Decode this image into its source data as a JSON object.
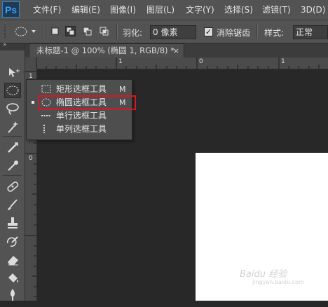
{
  "app": {
    "logo": "Ps"
  },
  "menubar": {
    "items": [
      "文件(F)",
      "编辑(E)",
      "图像(I)",
      "图层(L)",
      "文字(Y)",
      "选择(S)",
      "滤镜(T)",
      "3D(D)"
    ]
  },
  "options": {
    "feather_label": "羽化:",
    "feather_value": "0 像素",
    "antialias_label": "消除锯齿",
    "antialias_checked": true,
    "style_label": "样式:",
    "style_value": "正常"
  },
  "document_tab": {
    "title": "未标题-1 @ 100% (椭圆 1, RGB/8) *",
    "close_glyph": "×"
  },
  "rulers": {
    "top_labels": [
      "1",
      "0",
      "1"
    ],
    "left_labels": [
      "1",
      "0"
    ]
  },
  "tool_flyout": {
    "items": [
      {
        "label": "矩形选框工具",
        "shortcut": "M",
        "icon": "rect-marquee-icon",
        "active": false
      },
      {
        "label": "椭圆选框工具",
        "shortcut": "M",
        "icon": "ellipse-marquee-icon",
        "active": true
      },
      {
        "label": "单行选框工具",
        "shortcut": "",
        "icon": "single-row-marquee-icon",
        "active": false
      },
      {
        "label": "单列选框工具",
        "shortcut": "",
        "icon": "single-column-marquee-icon",
        "active": false
      }
    ]
  },
  "watermark": {
    "text": "Baidu 经验",
    "sub": "jingyan.baidu.com"
  },
  "colors": {
    "highlight": "#e0141f",
    "panel": "#535353",
    "workspace": "#282828"
  }
}
